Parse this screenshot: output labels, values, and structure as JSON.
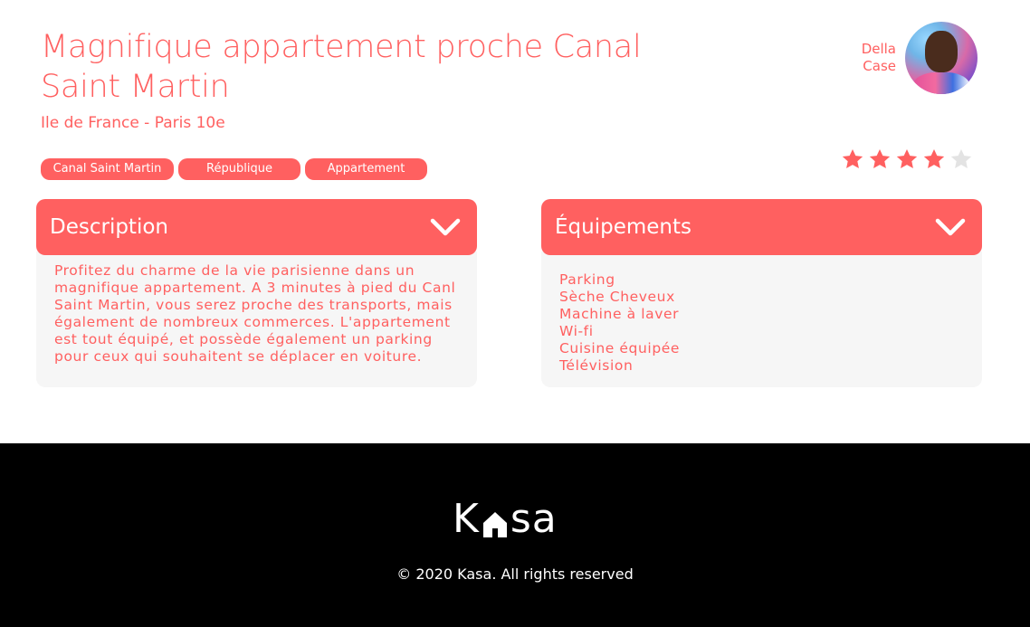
{
  "listing": {
    "title": "Magnifique appartement proche Canal Saint Martin",
    "location": "Ile de France - Paris 10e",
    "tags": [
      "Canal Saint Martin",
      "République",
      "Appartement"
    ],
    "rating": 4,
    "rating_max": 5
  },
  "host": {
    "first_name": "Della",
    "last_name": "Case"
  },
  "description": {
    "title": "Description",
    "text": "Profitez du charme de la vie parisienne dans un magnifique appartement. A 3 minutes à pied du Canl Saint Martin, vous serez proche des transports, mais également de nombreux commerces. L'appartement est tout équipé, et possède également un parking pour ceux qui souhaitent se déplacer en voiture."
  },
  "equipments": {
    "title": "Équipements",
    "items": [
      "Parking",
      "Sèche Cheveux",
      "Machine à laver",
      "Wi-fi",
      "Cuisine équipée",
      "Télévision"
    ]
  },
  "footer": {
    "logo_left": "K",
    "logo_right": "sa",
    "copyright": "© 2020 Kasa. All rights reserved"
  },
  "colors": {
    "accent": "#FF6060",
    "panel": "#F6F6F6",
    "star_empty": "#E3E3E3",
    "footer_bg": "#000000"
  },
  "icons": {
    "star": "star-icon",
    "chevron": "chevron-down-icon",
    "house": "house-icon"
  }
}
